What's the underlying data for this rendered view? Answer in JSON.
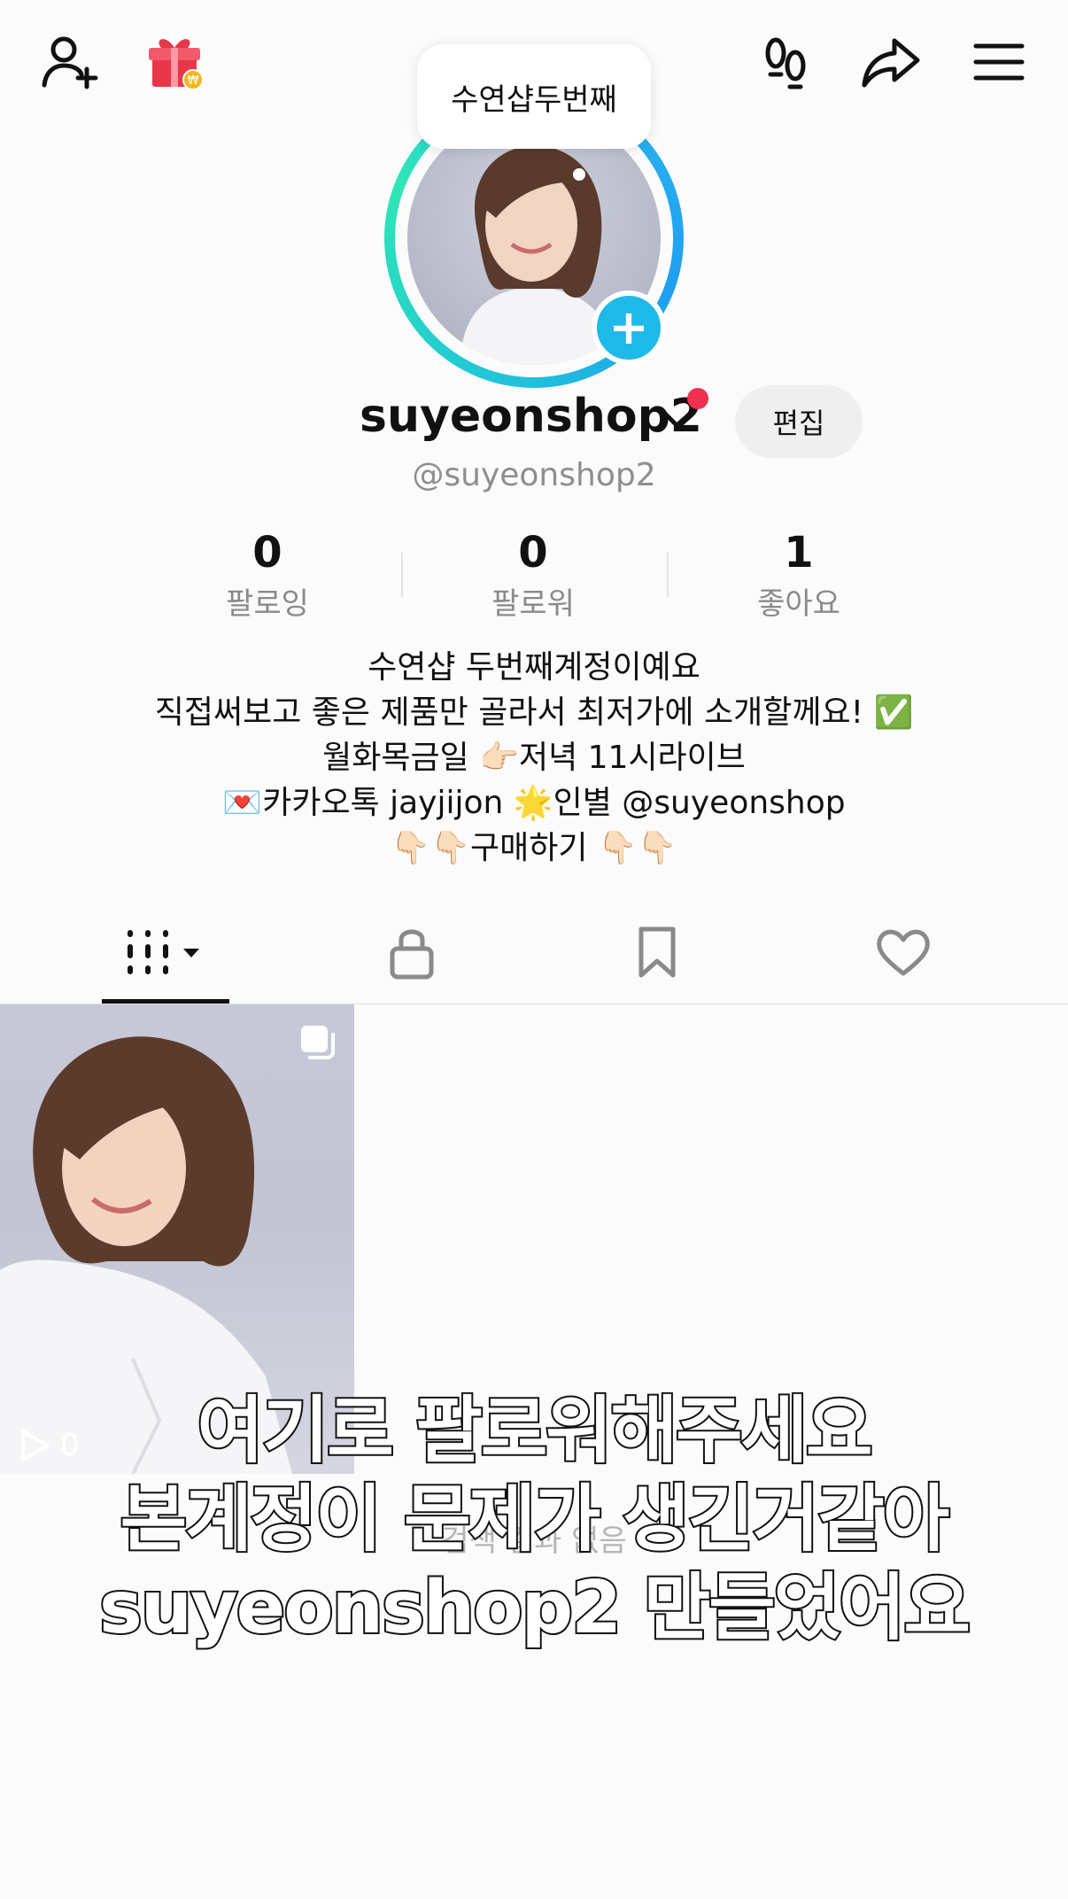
{
  "header": {
    "left_icons": [
      "add-friend-icon",
      "gift-icon"
    ],
    "right_icons": [
      "footprints-icon",
      "share-icon",
      "menu-icon"
    ],
    "tooltip": "수연샵두번째"
  },
  "profile": {
    "username": "suyeonshop2",
    "handle": "@suyeonshop2",
    "edit_label": "편집",
    "ring_colors": [
      "#21c7d6",
      "#2ee6b6",
      "#1f9ff0"
    ],
    "add_button_color": "#1fb9e8",
    "notification_color": "#f0304f"
  },
  "stats": [
    {
      "value": "0",
      "label": "팔로잉"
    },
    {
      "value": "0",
      "label": "팔로워"
    },
    {
      "value": "1",
      "label": "좋아요"
    }
  ],
  "bio": {
    "line1": "수연샵 두번째계정이예요",
    "line2": "직접써보고 좋은 제품만 골라서 최저가에 소개할께요! ✅",
    "line3": "월화목금일 👉🏻저녁 11시라이브",
    "line4": "💌카카오톡 jayjijon 🌟인별 @suyeonshop",
    "line5": "👇🏻👇🏻구매하기 👇🏻👇🏻"
  },
  "tabs": [
    {
      "icon": "grid-icon",
      "selected": true
    },
    {
      "icon": "lock-icon",
      "selected": false
    },
    {
      "icon": "bookmark-icon",
      "selected": false
    },
    {
      "icon": "heart-icon",
      "selected": false
    }
  ],
  "videos": [
    {
      "views": "0",
      "icons": [
        "multi-photo-icon",
        "play-icon"
      ]
    }
  ],
  "empty_state": "검색 결과 없음",
  "caption": {
    "line1": "여기로 팔로워해주세요",
    "line2": "본계정이 문제가 생긴거같아",
    "line3": "suyeonshop2 만들었어요"
  }
}
